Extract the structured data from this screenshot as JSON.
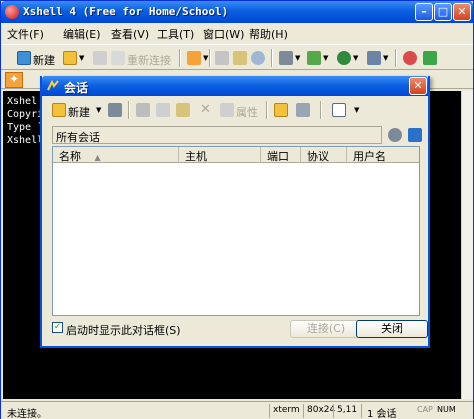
{
  "window": {
    "title": "Xshell 4 (Free for Home/School)"
  },
  "menu": [
    "文件(F)",
    "编辑(E)",
    "查看(V)",
    "工具(T)",
    "窗口(W)",
    "帮助(H)"
  ],
  "toolbar": {
    "new_label": "新建",
    "reconnect_label": "重新连接"
  },
  "terminal": {
    "lines": [
      "Xshel",
      "Copyri",
      "",
      "Type `",
      "Xshell"
    ]
  },
  "status": {
    "message": "未连接。",
    "term": "xterm",
    "size": "80x24",
    "cursor": "5,11",
    "sessions": "1 会话",
    "caps": "CAP",
    "num": "NUM"
  },
  "dialog": {
    "title": "会话",
    "new_label": "新建",
    "properties_label": "属性",
    "path": "所有会话",
    "columns": [
      "名称",
      "主机",
      "端口",
      "协议",
      "用户名"
    ],
    "startup_label": "启动时显示此对话框(S)",
    "startup_checked": true,
    "connect_label": "连接(C)",
    "close_label": "关闭"
  },
  "colors": {
    "titlebar": "#0a5fe0",
    "terminal_bg": "#000000",
    "accent": "#f5a23a"
  }
}
